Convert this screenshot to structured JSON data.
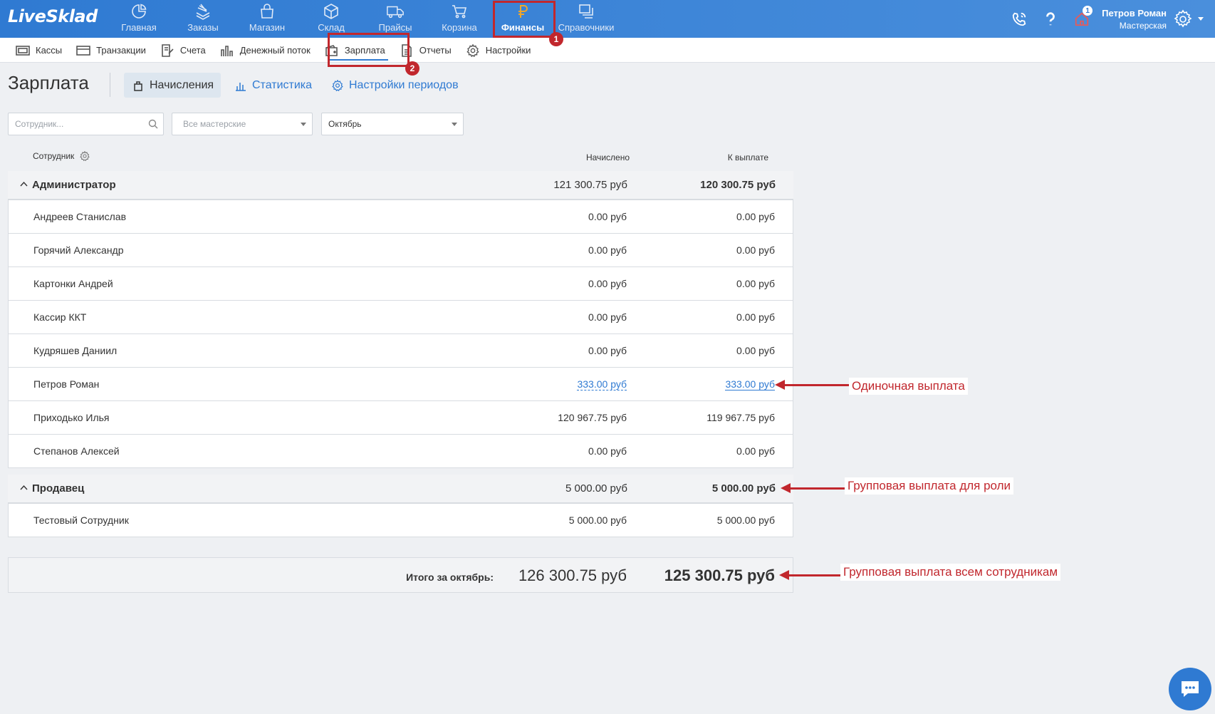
{
  "app": {
    "logo": "LiveSklad"
  },
  "topnav": {
    "items": [
      {
        "label": "Главная",
        "icon": "pie-chart-icon"
      },
      {
        "label": "Заказы",
        "icon": "stack-icon"
      },
      {
        "label": "Магазин",
        "icon": "shopping-bag-icon"
      },
      {
        "label": "Склад",
        "icon": "box-icon"
      },
      {
        "label": "Прайсы",
        "icon": "truck-icon"
      },
      {
        "label": "Корзина",
        "icon": "cart-icon"
      },
      {
        "label": "Финансы",
        "icon": "ruble-icon",
        "active": true
      },
      {
        "label": "Справочники",
        "icon": "windows-icon"
      }
    ],
    "notification_count": "1",
    "user_name": "Петров Роман",
    "user_org": "Мастерская"
  },
  "subnav": {
    "items": [
      {
        "label": "Кассы"
      },
      {
        "label": "Транзакции"
      },
      {
        "label": "Счета"
      },
      {
        "label": "Денежный поток"
      },
      {
        "label": "Зарплата",
        "active": true
      },
      {
        "label": "Отчеты"
      },
      {
        "label": "Настройки"
      }
    ]
  },
  "page": {
    "title": "Зарплата",
    "tabs": [
      {
        "label": "Начисления",
        "active": true
      },
      {
        "label": "Статистика"
      },
      {
        "label": "Настройки периодов"
      }
    ]
  },
  "filters": {
    "employee_placeholder": "Сотрудник...",
    "shop_value": "Все мастерские",
    "month_value": "Октябрь"
  },
  "table": {
    "col_employee": "Сотрудник",
    "col_accrued": "Начислено",
    "col_payout": "К выплате",
    "groups": [
      {
        "name": "Администратор",
        "accrued": "121 300.75 руб",
        "payout": "120 300.75 руб",
        "rows": [
          {
            "name": "Андреев Станислав",
            "accrued": "0.00 руб",
            "payout": "0.00 руб"
          },
          {
            "name": "Горячий Александр",
            "accrued": "0.00 руб",
            "payout": "0.00 руб"
          },
          {
            "name": "Картонки Андрей",
            "accrued": "0.00 руб",
            "payout": "0.00 руб"
          },
          {
            "name": "Кассир ККТ",
            "accrued": "0.00 руб",
            "payout": "0.00 руб"
          },
          {
            "name": "Кудряшев Даниил",
            "accrued": "0.00 руб",
            "payout": "0.00 руб"
          },
          {
            "name": "Петров Роман",
            "accrued": "333.00 руб",
            "payout": "333.00 руб"
          },
          {
            "name": "Приходько Илья",
            "accrued": "120 967.75 руб",
            "payout": "119 967.75 руб"
          },
          {
            "name": "Степанов Алексей",
            "accrued": "0.00 руб",
            "payout": "0.00 руб"
          }
        ]
      },
      {
        "name": "Продавец",
        "accrued": "5 000.00 руб",
        "payout": "5 000.00 руб",
        "rows": [
          {
            "name": "Тестовый Сотрудник",
            "accrued": "5 000.00 руб",
            "payout": "5 000.00 руб"
          }
        ]
      }
    ],
    "total_label": "Итого за октябрь:",
    "total_accrued": "126 300.75 руб",
    "total_payout": "125 300.75 руб"
  },
  "annotations": {
    "marker_1": "1",
    "marker_2": "2",
    "single_payout": "Одиночная выплата",
    "group_role_payout": "Групповая выплата для роли",
    "group_all_payout": "Групповая выплата всем сотрудникам"
  },
  "colors": {
    "accent": "#2f7ad2",
    "annotation": "#c1272d"
  }
}
